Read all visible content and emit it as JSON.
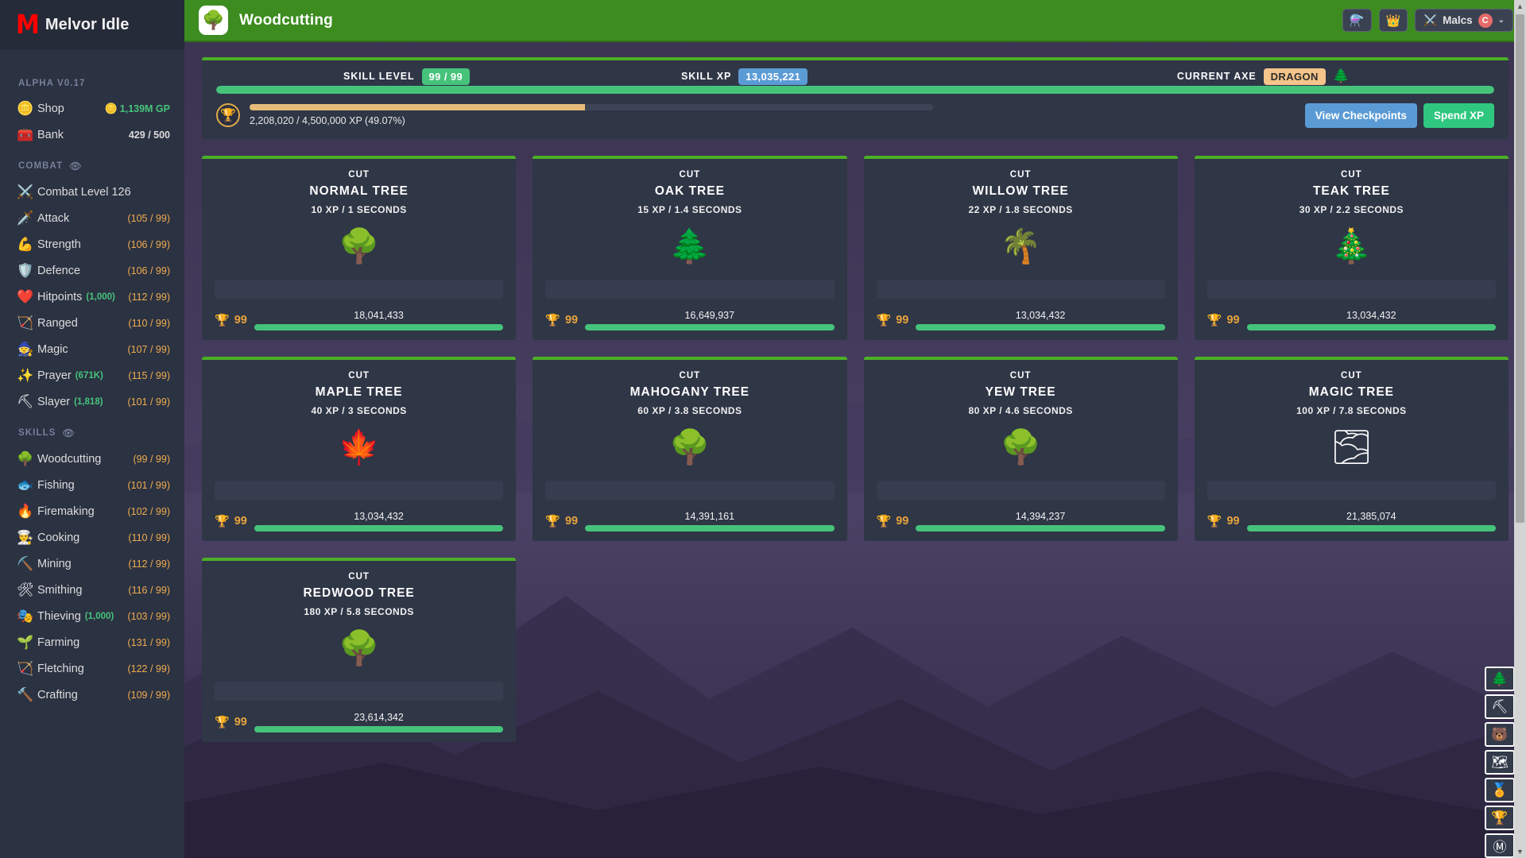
{
  "brand": {
    "logo": "M",
    "name": "Melvor Idle"
  },
  "sidebar": {
    "version": "ALPHA V0.17",
    "top_items": [
      {
        "icon": "🪙",
        "label": "Shop",
        "right_icon": "🪙",
        "right": "1,139M GP",
        "right_style": "green"
      },
      {
        "icon": "🧰",
        "label": "Bank",
        "right": "429 / 500",
        "right_style": "white"
      }
    ],
    "combat_heading": "COMBAT",
    "skills_heading": "SKILLS",
    "eye_icon": "👁",
    "combat_items": [
      {
        "icon": "⚔️",
        "label": "Combat Level 126",
        "right": ""
      },
      {
        "icon": "🗡️",
        "label": "Attack",
        "right": "(105 / 99)"
      },
      {
        "icon": "💪",
        "label": "Strength",
        "right": "(106 / 99)"
      },
      {
        "icon": "🛡️",
        "label": "Defence",
        "right": "(106 / 99)"
      },
      {
        "icon": "❤️",
        "label": "Hitpoints",
        "sub": "(1,000)",
        "right": "(112 / 99)"
      },
      {
        "icon": "🏹",
        "label": "Ranged",
        "right": "(110 / 99)"
      },
      {
        "icon": "🧙",
        "label": "Magic",
        "right": "(107 / 99)"
      },
      {
        "icon": "✨",
        "label": "Prayer",
        "sub": "(671K)",
        "right": "(115 / 99)"
      },
      {
        "icon": "⛏",
        "label": "Slayer",
        "sub": "(1,818)",
        "right": "(101 / 99)"
      }
    ],
    "skill_items": [
      {
        "icon": "🌳",
        "label": "Woodcutting",
        "right": "(99 / 99)"
      },
      {
        "icon": "🐟",
        "label": "Fishing",
        "right": "(101 / 99)"
      },
      {
        "icon": "🔥",
        "label": "Firemaking",
        "right": "(102 / 99)"
      },
      {
        "icon": "👨‍🍳",
        "label": "Cooking",
        "right": "(110 / 99)"
      },
      {
        "icon": "⛏️",
        "label": "Mining",
        "right": "(112 / 99)"
      },
      {
        "icon": "🛠",
        "label": "Smithing",
        "right": "(116 / 99)"
      },
      {
        "icon": "🎭",
        "label": "Thieving",
        "sub": "(1,000)",
        "right": "(103 / 99)"
      },
      {
        "icon": "🌱",
        "label": "Farming",
        "right": "(131 / 99)"
      },
      {
        "icon": "🏹",
        "label": "Fletching",
        "right": "(122 / 99)"
      },
      {
        "icon": "🔨",
        "label": "Crafting",
        "right": "(109 / 99)"
      }
    ]
  },
  "topbar": {
    "skill_icon": "🌳",
    "title": "Woodcutting",
    "potion_icon": "⚗️",
    "crown_icon": "👑",
    "user_icon": "⚔️",
    "username": "Malcs",
    "user_badge": "C",
    "caret": "⌄"
  },
  "summary": {
    "skill_level_label": "SKILL LEVEL",
    "skill_level_value": "99 / 99",
    "skill_xp_label": "SKILL XP",
    "skill_xp_value": "13,035,221",
    "current_axe_label": "CURRENT AXE",
    "current_axe_value": "DRAGON",
    "axe_icon": "🌲",
    "mastery_pool_percent": 100,
    "trophy_icon": "🏆",
    "pool_text": "2,208,020 / 4,500,000 XP (49.07%)",
    "pool_percent": 49.07,
    "view_checkpoints_label": "View Checkpoints",
    "spend_xp_label": "Spend XP"
  },
  "trees": [
    {
      "action": "CUT",
      "name": "NORMAL TREE",
      "xp": "10 XP / 1 SECONDS",
      "icon": "🌳",
      "mastery_level": "99",
      "mastery_xp": "18,041,433",
      "mastery_percent": 100
    },
    {
      "action": "CUT",
      "name": "OAK TREE",
      "xp": "15 XP / 1.4 SECONDS",
      "icon": "🌲",
      "mastery_level": "99",
      "mastery_xp": "16,649,937",
      "mastery_percent": 100
    },
    {
      "action": "CUT",
      "name": "WILLOW TREE",
      "xp": "22 XP / 1.8 SECONDS",
      "icon": "🌴",
      "mastery_level": "99",
      "mastery_xp": "13,034,432",
      "mastery_percent": 100
    },
    {
      "action": "CUT",
      "name": "TEAK TREE",
      "xp": "30 XP / 2.2 SECONDS",
      "icon": "🎄",
      "mastery_level": "99",
      "mastery_xp": "13,034,432",
      "mastery_percent": 100
    },
    {
      "action": "CUT",
      "name": "MAPLE TREE",
      "xp": "40 XP / 3 SECONDS",
      "icon": "🍁",
      "mastery_level": "99",
      "mastery_xp": "13,034,432",
      "mastery_percent": 100
    },
    {
      "action": "CUT",
      "name": "MAHOGANY TREE",
      "xp": "60 XP / 3.8 SECONDS",
      "icon": "🌳",
      "mastery_level": "99",
      "mastery_xp": "14,391,161",
      "mastery_percent": 100
    },
    {
      "action": "CUT",
      "name": "YEW TREE",
      "xp": "80 XP / 4.6 SECONDS",
      "icon": "🌳",
      "mastery_level": "99",
      "mastery_xp": "14,394,237",
      "mastery_percent": 100
    },
    {
      "action": "CUT",
      "name": "MAGIC TREE",
      "xp": "100 XP / 7.8 SECONDS",
      "icon": "🌫",
      "mastery_level": "99",
      "mastery_xp": "21,385,074",
      "mastery_percent": 100
    },
    {
      "action": "CUT",
      "name": "REDWOOD TREE",
      "xp": "180 XP / 5.8 SECONDS",
      "icon": "🌳",
      "mastery_level": "99",
      "mastery_xp": "23,614,342",
      "mastery_percent": 100
    }
  ],
  "dock": [
    {
      "icon": "🌲",
      "name": "dock-trees"
    },
    {
      "icon": "⛏",
      "name": "dock-woodcut-mine"
    },
    {
      "icon": "🐻",
      "name": "dock-bear"
    },
    {
      "icon": "🗺",
      "name": "dock-map"
    },
    {
      "icon": "🏅",
      "name": "dock-medal"
    },
    {
      "icon": "🏆",
      "name": "dock-trophy"
    },
    {
      "icon": "Ⓜ",
      "name": "dock-melvor"
    }
  ],
  "colors": {
    "brand_red": "#ff0000",
    "header_green": "#3c8c20",
    "accent_green": "#46c37b",
    "accent_blue": "#5b9bd5",
    "accent_orange": "#f0ad4e",
    "panel_bg": "#2f3646",
    "sidebar_bg": "#2b3242"
  },
  "scrollbar": {
    "up_arrow": "▲",
    "down_arrow": "▼"
  }
}
